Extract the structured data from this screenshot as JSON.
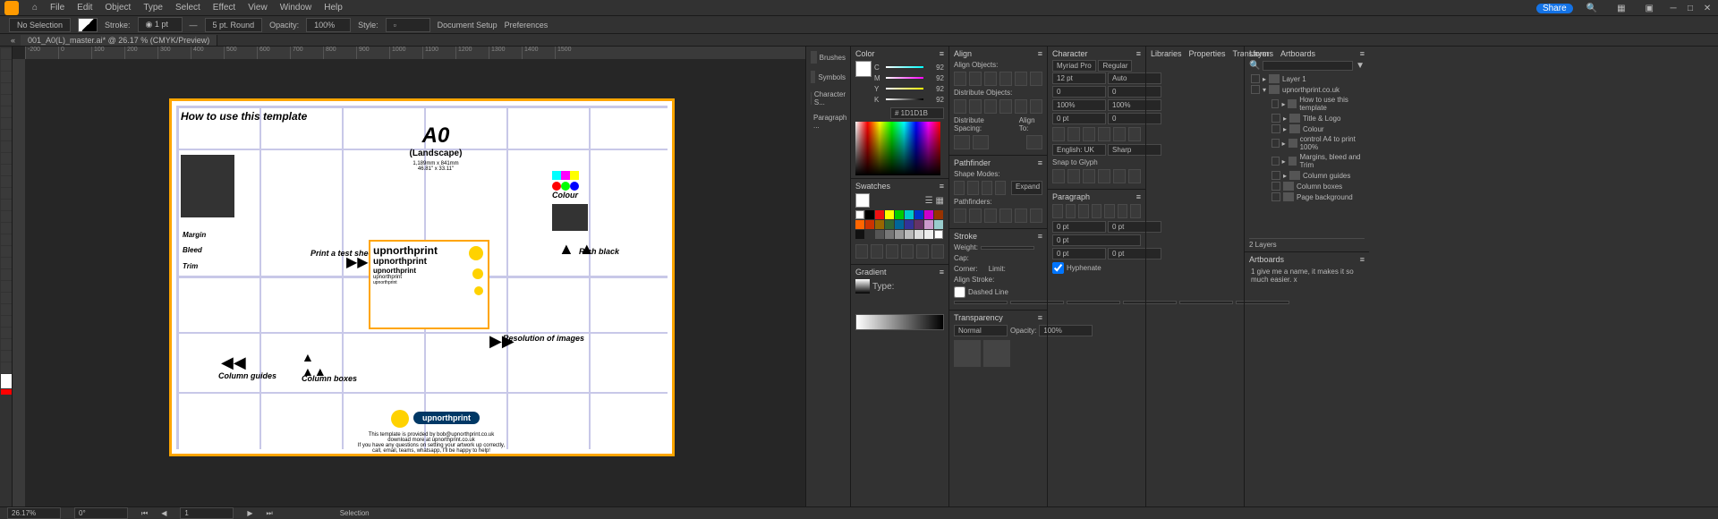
{
  "menu": {
    "file": "File",
    "edit": "Edit",
    "object": "Object",
    "type": "Type",
    "select": "Select",
    "effect": "Effect",
    "view": "View",
    "window": "Window",
    "help": "Help"
  },
  "share": "Share",
  "controlbar": {
    "noSelection": "No Selection",
    "stroke": "Stroke:",
    "strokeVal": "5 pt. Round",
    "opacity": "Opacity:",
    "opacityVal": "100%",
    "style": "Style:",
    "docSetup": "Document Setup",
    "prefs": "Preferences"
  },
  "tab": "001_A0(L)_master.ai* @ 26.17 % (CMYK/Preview)",
  "ruler": [
    "-200",
    "0",
    "100",
    "200",
    "300",
    "400",
    "500",
    "600",
    "700",
    "800",
    "900",
    "1000",
    "1100",
    "1200",
    "1300",
    "1400",
    "1500"
  ],
  "artboard": {
    "title": "How to use this template",
    "a0": "A0",
    "a0sub": "(Landscape)",
    "a0dim": "1,189mm x 841mm\n46.81\" x 33.11\"",
    "margin": "Margin",
    "bleed": "Bleed",
    "trim": "Trim",
    "printTest": "Print a test sheet",
    "upnorth": "upnorthprint",
    "colour": "Colour",
    "richblack": "Rich black",
    "resolution": "Resolution of images",
    "colguides": "Column guides",
    "colboxes": "Column boxes",
    "footer1": "This template is provided by bob@upnorthprint.co.uk",
    "footer2": "download more at upnorthprint.co.uk",
    "footer3": "If you have any questions on setting your artwork up correctly,",
    "footer4": "call, email, teams, whatsapp, I'll be happy to help!"
  },
  "dock": {
    "brushes": "Brushes",
    "symbols": "Symbols",
    "charStyles": "Character S...",
    "paraStyles": "Paragraph ..."
  },
  "panels": {
    "color": {
      "tab": "Color",
      "c": "C",
      "m": "M",
      "y": "Y",
      "k": "K",
      "val": "92",
      "hex": "# 1D1D1B"
    },
    "swatches": {
      "tab": "Swatches"
    },
    "gradient": {
      "tab": "Gradient",
      "type": "Type:"
    },
    "align": {
      "tab": "Align",
      "alignObj": "Align Objects:",
      "distObj": "Distribute Objects:",
      "distSpace": "Distribute Spacing:",
      "alignTo": "Align To:"
    },
    "pathfinder": {
      "tab": "Pathfinder",
      "shapeModes": "Shape Modes:",
      "pathfinders": "Pathfinders:"
    },
    "stroke": {
      "tab": "Stroke",
      "weight": "Weight:",
      "cap": "Cap:",
      "corner": "Corner:",
      "limit": "Limit:",
      "alignStroke": "Align Stroke:",
      "dashed": "Dashed Line"
    },
    "transparency": {
      "tab": "Transparency",
      "normal": "Normal",
      "opacity": "Opacity:",
      "opacityVal": "100%"
    },
    "character": {
      "tab": "Character",
      "font": "Myriad Pro",
      "style": "Regular",
      "size": "12 pt",
      "leading": "Auto",
      "kerning": "0",
      "tracking": "100%",
      "scale": "100%",
      "baseline": "0 pt",
      "lang": "English: UK",
      "aa": "Sharp",
      "snap": "Snap to Glyph"
    },
    "paragraph": {
      "tab": "Paragraph",
      "left": "0 pt",
      "right": "0 pt",
      "firstline": "0 pt",
      "before": "0 pt",
      "after": "0 pt",
      "hyphenate": "Hyphenate"
    },
    "libraries": "Libraries",
    "properties": "Properties",
    "transform": "Transform",
    "layers": {
      "tab": "Layers",
      "artboards": "Artboards",
      "items": [
        "Layer 1",
        "upnorthprint.co.uk",
        "How to use this template",
        "Title & Logo",
        "Colour",
        "control A4 to print 100%",
        "Margins, bleed and Trim",
        "Column guides",
        "Column boxes",
        "Page background"
      ],
      "count": "2 Layers",
      "artboardName": "1   give me a name, it makes it so much easier. x"
    }
  },
  "status": {
    "zoom": "26.17%",
    "rotate": "0°",
    "artboard": "1",
    "tool": "Selection"
  }
}
